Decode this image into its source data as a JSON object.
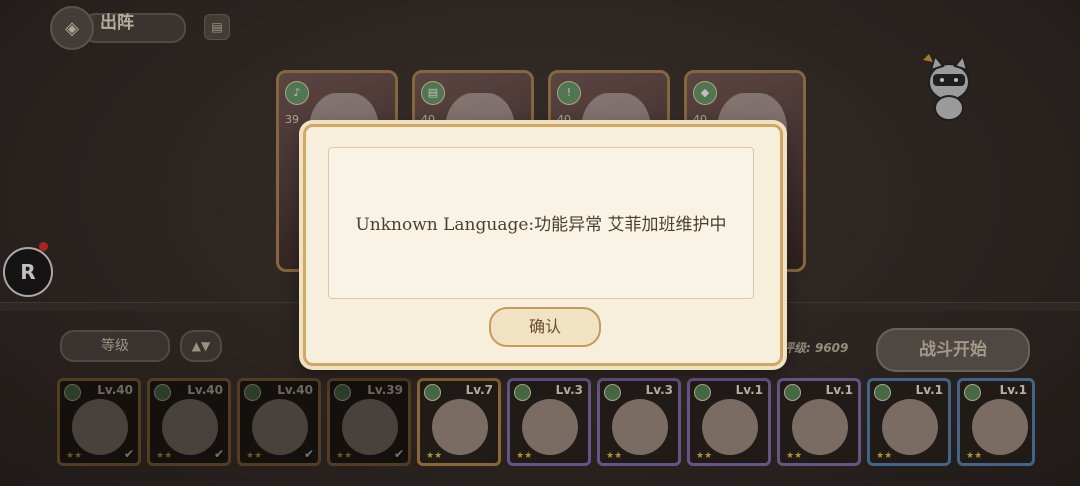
{
  "header": {
    "title": "出阵"
  },
  "team": [
    {
      "level": "39"
    },
    {
      "level": "40"
    },
    {
      "level": "40"
    },
    {
      "level": "40"
    }
  ],
  "controls": {
    "sort_label": "等级",
    "sort_icon": "sort-arrows-icon",
    "power_text": "合奏评级: 9609",
    "start_label": "战斗开始"
  },
  "roster": [
    {
      "level": "Lv.40",
      "selected": true
    },
    {
      "level": "Lv.40",
      "selected": true
    },
    {
      "level": "Lv.40",
      "selected": true
    },
    {
      "level": "Lv.39",
      "selected": true
    },
    {
      "level": "Lv.7",
      "selected": false
    },
    {
      "level": "Lv.3",
      "selected": false
    },
    {
      "level": "Lv.3",
      "selected": false
    },
    {
      "level": "Lv.1",
      "selected": false
    },
    {
      "level": "Lv.1",
      "selected": false
    },
    {
      "level": "Lv.1",
      "selected": false
    },
    {
      "level": "Lv.1",
      "selected": false
    }
  ],
  "dialog": {
    "message": "Unknown Language:功能异常 艾菲加班维护中",
    "confirm_label": "确认"
  }
}
